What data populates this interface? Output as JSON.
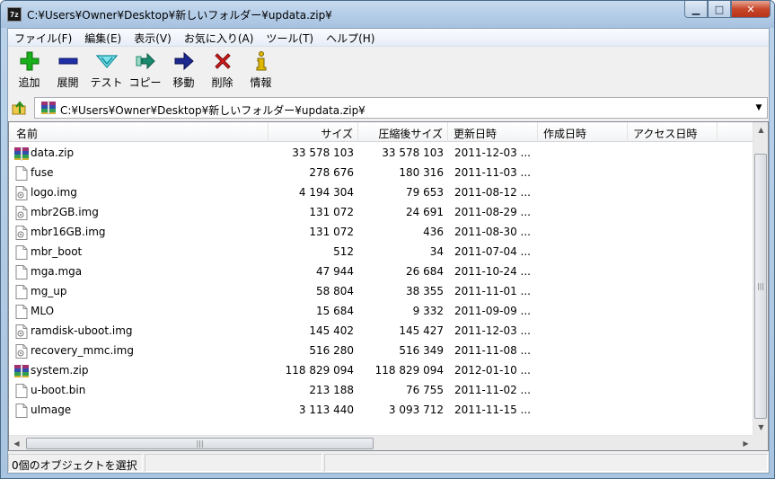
{
  "window": {
    "title": "C:¥Users¥Owner¥Desktop¥新しいフォルダー¥updata.zip¥",
    "app_icon_text": "7z",
    "buttons": {
      "minimize": "▁",
      "maximize": "□",
      "close": "✕"
    }
  },
  "menu": [
    {
      "label": "ファイル(F)"
    },
    {
      "label": "編集(E)"
    },
    {
      "label": "表示(V)"
    },
    {
      "label": "お気に入り(A)"
    },
    {
      "label": "ツール(T)"
    },
    {
      "label": "ヘルプ(H)"
    }
  ],
  "toolbar": [
    {
      "label": "追加",
      "icon": "add-plus-icon",
      "color": "#19b01b"
    },
    {
      "label": "展開",
      "icon": "extract-minus-icon",
      "color": "#1e2fa8"
    },
    {
      "label": "テスト",
      "icon": "test-check-icon",
      "color": "#14a9b8"
    },
    {
      "label": "コピー",
      "icon": "copy-arrow-icon",
      "color": "#1a8a6e"
    },
    {
      "label": "移動",
      "icon": "move-arrow-icon",
      "color": "#1a2890"
    },
    {
      "label": "削除",
      "icon": "delete-x-icon",
      "color": "#d21c1c"
    },
    {
      "label": "情報",
      "icon": "info-icon",
      "color": "#c9a400"
    }
  ],
  "address": {
    "path": "C:¥Users¥Owner¥Desktop¥新しいフォルダー¥updata.zip¥",
    "dropdown": "▼"
  },
  "columns": {
    "name": "名前",
    "size": "サイズ",
    "packed": "圧縮後サイズ",
    "modified": "更新日時",
    "created": "作成日時",
    "accessed": "アクセス日時"
  },
  "files": [
    {
      "name": "data.zip",
      "size": "33 578 103",
      "packed": "33 578 103",
      "modified": "2011-12-03 ...",
      "type": "archive"
    },
    {
      "name": "fuse",
      "size": "278 676",
      "packed": "180 316",
      "modified": "2011-11-03 ...",
      "type": "file"
    },
    {
      "name": "logo.img",
      "size": "4 194 304",
      "packed": "79 653",
      "modified": "2011-08-12 ...",
      "type": "image"
    },
    {
      "name": "mbr2GB.img",
      "size": "131 072",
      "packed": "24 691",
      "modified": "2011-08-29 ...",
      "type": "image"
    },
    {
      "name": "mbr16GB.img",
      "size": "131 072",
      "packed": "436",
      "modified": "2011-08-30 ...",
      "type": "image"
    },
    {
      "name": "mbr_boot",
      "size": "512",
      "packed": "34",
      "modified": "2011-07-04 ...",
      "type": "file"
    },
    {
      "name": "mga.mga",
      "size": "47 944",
      "packed": "26 684",
      "modified": "2011-10-24 ...",
      "type": "file"
    },
    {
      "name": "mg_up",
      "size": "58 804",
      "packed": "38 355",
      "modified": "2011-11-01 ...",
      "type": "file"
    },
    {
      "name": "MLO",
      "size": "15 684",
      "packed": "9 332",
      "modified": "2011-09-09 ...",
      "type": "file"
    },
    {
      "name": "ramdisk-uboot.img",
      "size": "145 402",
      "packed": "145 427",
      "modified": "2011-12-03 ...",
      "type": "image"
    },
    {
      "name": "recovery_mmc.img",
      "size": "516 280",
      "packed": "516 349",
      "modified": "2011-11-08 ...",
      "type": "image"
    },
    {
      "name": "system.zip",
      "size": "118 829 094",
      "packed": "118 829 094",
      "modified": "2012-01-10 ...",
      "type": "archive"
    },
    {
      "name": "u-boot.bin",
      "size": "213 188",
      "packed": "76 755",
      "modified": "2011-11-02 ...",
      "type": "file"
    },
    {
      "name": "uImage",
      "size": "3 113 440",
      "packed": "3 093 712",
      "modified": "2011-11-15 ...",
      "type": "file"
    }
  ],
  "scrollbar": {
    "up": "▲",
    "down": "▼",
    "left": "◀",
    "right": "▶",
    "grip": "|||"
  },
  "status": {
    "selection": "0個のオブジェクトを選択"
  }
}
